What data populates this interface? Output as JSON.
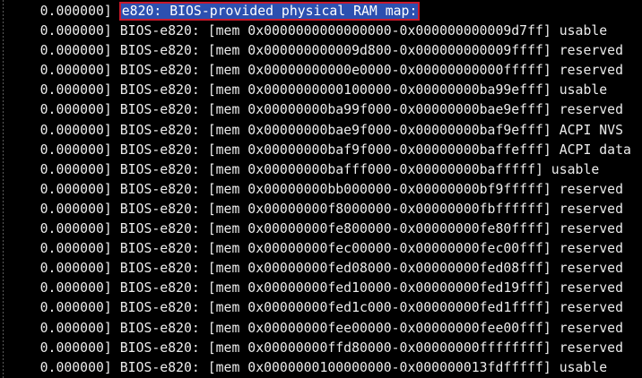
{
  "terminal": {
    "header": {
      "timestamp": "0.000000]",
      "message": "e820: BIOS-provided physical RAM map:"
    },
    "lines": [
      {
        "timestamp": "0.000000]",
        "text": "BIOS-e820: [mem 0x0000000000000000-0x000000000009d7ff] usable"
      },
      {
        "timestamp": "0.000000]",
        "text": "BIOS-e820: [mem 0x000000000009d800-0x000000000009ffff] reserved"
      },
      {
        "timestamp": "0.000000]",
        "text": "BIOS-e820: [mem 0x00000000000e0000-0x00000000000fffff] reserved"
      },
      {
        "timestamp": "0.000000]",
        "text": "BIOS-e820: [mem 0x0000000000100000-0x00000000ba99efff] usable"
      },
      {
        "timestamp": "0.000000]",
        "text": "BIOS-e820: [mem 0x00000000ba99f000-0x00000000bae9efff] reserved"
      },
      {
        "timestamp": "0.000000]",
        "text": "BIOS-e820: [mem 0x00000000bae9f000-0x00000000baf9efff] ACPI NVS"
      },
      {
        "timestamp": "0.000000]",
        "text": "BIOS-e820: [mem 0x00000000baf9f000-0x00000000baffefff] ACPI data"
      },
      {
        "timestamp": "0.000000]",
        "text": "BIOS-e820: [mem 0x00000000bafff000-0x00000000bafffff] usable"
      },
      {
        "timestamp": "0.000000]",
        "text": "BIOS-e820: [mem 0x00000000bb000000-0x00000000bf9fffff] reserved"
      },
      {
        "timestamp": "0.000000]",
        "text": "BIOS-e820: [mem 0x00000000f8000000-0x00000000fbffffff] reserved"
      },
      {
        "timestamp": "0.000000]",
        "text": "BIOS-e820: [mem 0x00000000fe800000-0x00000000fe80ffff] reserved"
      },
      {
        "timestamp": "0.000000]",
        "text": "BIOS-e820: [mem 0x00000000fec00000-0x00000000fec00fff] reserved"
      },
      {
        "timestamp": "0.000000]",
        "text": "BIOS-e820: [mem 0x00000000fed08000-0x00000000fed08fff] reserved"
      },
      {
        "timestamp": "0.000000]",
        "text": "BIOS-e820: [mem 0x00000000fed10000-0x00000000fed19fff] reserved"
      },
      {
        "timestamp": "0.000000]",
        "text": "BIOS-e820: [mem 0x00000000fed1c000-0x00000000fed1ffff] reserved"
      },
      {
        "timestamp": "0.000000]",
        "text": "BIOS-e820: [mem 0x00000000fee00000-0x00000000fee00fff] reserved"
      },
      {
        "timestamp": "0.000000]",
        "text": "BIOS-e820: [mem 0x00000000ffd80000-0x00000000ffffffff] reserved"
      },
      {
        "timestamp": "0.000000]",
        "text": "BIOS-e820: [mem 0x0000000100000000-0x000000013fdfffff] usable"
      }
    ],
    "colors": {
      "background": "#000000",
      "text": "#ececec",
      "highlight_background": "#2c50b0",
      "highlight_border": "#c8192b"
    }
  }
}
